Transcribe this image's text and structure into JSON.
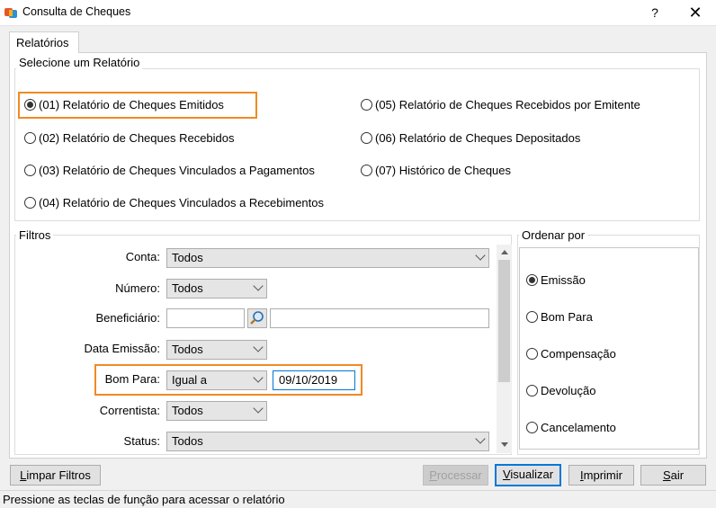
{
  "window": {
    "title": "Consulta de Cheques",
    "help_glyph": "?",
    "close_glyph": "✕"
  },
  "tab": {
    "label": "Relatórios"
  },
  "report_group": {
    "legend": "Selecione um Relatório",
    "options": [
      {
        "label": "(01) Relatório de Cheques Emitidos",
        "checked": true
      },
      {
        "label": "(02) Relatório de Cheques Recebidos",
        "checked": false
      },
      {
        "label": "(03) Relatório de Cheques Vinculados a Pagamentos",
        "checked": false
      },
      {
        "label": "(04) Relatório de Cheques Vinculados a Recebimentos",
        "checked": false
      },
      {
        "label": "(05) Relatório de Cheques Recebidos por Emitente",
        "checked": false
      },
      {
        "label": "(06) Relatório de Cheques Depositados",
        "checked": false
      },
      {
        "label": "(07) Histórico de Cheques",
        "checked": false
      }
    ]
  },
  "filters": {
    "legend": "Filtros",
    "conta": {
      "label": "Conta:",
      "value": "Todos"
    },
    "numero": {
      "label": "Número:",
      "value": "Todos"
    },
    "beneficiario": {
      "label": "Beneficiário:",
      "code": "",
      "name": ""
    },
    "data_emissao": {
      "label": "Data Emissão:",
      "value": "Todos"
    },
    "bom_para": {
      "label": "Bom Para:",
      "value": "Igual a",
      "date": "09/10/2019"
    },
    "correntista": {
      "label": "Correntista:",
      "value": "Todos"
    },
    "status": {
      "label": "Status:",
      "value": "Todos"
    }
  },
  "order_group": {
    "legend": "Ordenar por",
    "options": [
      {
        "label": "Emissão",
        "checked": true
      },
      {
        "label": "Bom Para",
        "checked": false
      },
      {
        "label": "Compensação",
        "checked": false
      },
      {
        "label": "Devolução",
        "checked": false
      },
      {
        "label": "Cancelamento",
        "checked": false
      }
    ]
  },
  "buttons": {
    "limpar": {
      "mnemonic": "L",
      "rest": "impar Filtros"
    },
    "processar": {
      "mnemonic": "P",
      "rest": "rocessar",
      "disabled": true
    },
    "visualizar": {
      "mnemonic": "V",
      "rest": "isualizar"
    },
    "imprimir": {
      "mnemonic": "I",
      "rest": "mprimir"
    },
    "sair": {
      "mnemonic": "S",
      "rest": "air"
    }
  },
  "status_text": "Pressione as teclas de função para acessar o relatório",
  "colors": {
    "highlight": "#f08a24",
    "focus": "#0078d7"
  }
}
